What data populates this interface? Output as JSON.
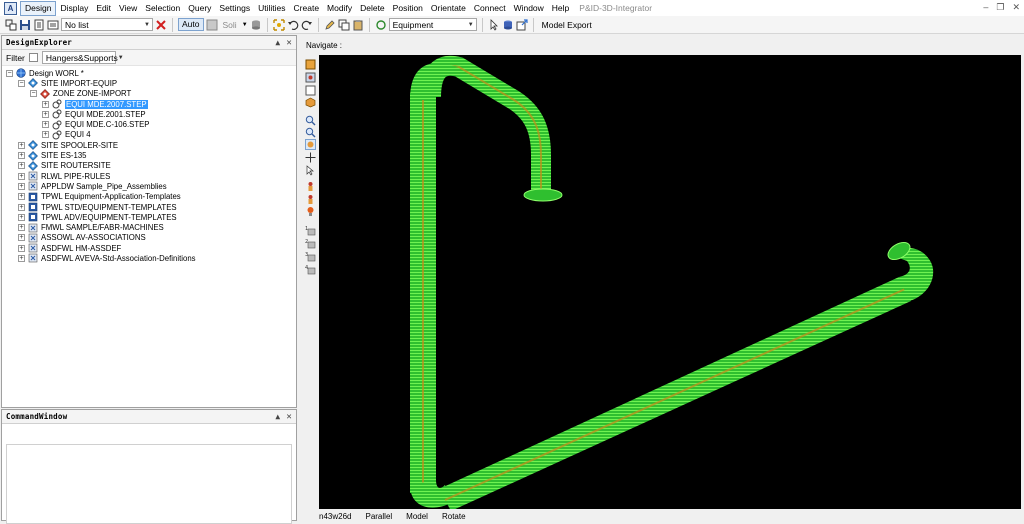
{
  "menubar": {
    "items": [
      "Design",
      "Display",
      "Edit",
      "View",
      "Selection",
      "Query",
      "Settings",
      "Utilities",
      "Create",
      "Modify",
      "Delete",
      "Position",
      "Orientate",
      "Connect",
      "Window",
      "Help"
    ],
    "title": "P&ID-3D-Integrator"
  },
  "toolbar": {
    "list_value": "No list",
    "auto_label": "Auto",
    "solid_label": "Soli",
    "equipment_value": "Equipment",
    "model_export_label": "Model Export"
  },
  "explorer": {
    "title": "DesignExplorer",
    "filter_label": "Filter",
    "filter_value": "Hangers&Supports",
    "nodes": [
      "Design WORL *",
      "SITE IMPORT-EQUIP",
      "ZONE ZONE-IMPORT",
      "EQUI MDE.2007.STEP",
      "EQUI MDE.2001.STEP",
      "EQUI MDE.C-106.STEP",
      "EQUI 4",
      "SITE SPOOLER-SITE",
      "SITE ES-135",
      "SITE ROUTERSITE",
      "RLWL PIPE-RULES",
      "APPLDW Sample_Pipe_Assemblies",
      "TPWL Equipment-Application-Templates",
      "TPWL STD/EQUIPMENT-TEMPLATES",
      "TPWL ADV/EQUIPMENT-TEMPLATES",
      "FMWL SAMPLE/FABR-MACHINES",
      "ASSOWL AV-ASSOCIATIONS",
      "ASDFWL HM-ASSDEF",
      "ASDFWL AVEVA-Std-Association-Definitions"
    ]
  },
  "command_window": {
    "title": "CommandWindow"
  },
  "view": {
    "navigate_label": "Navigate :",
    "pipe_color": "#39e03a",
    "background": "#000000"
  },
  "status": {
    "direction": "n43w26d",
    "projection": "Parallel",
    "mode": "Model",
    "action": "Rotate"
  }
}
